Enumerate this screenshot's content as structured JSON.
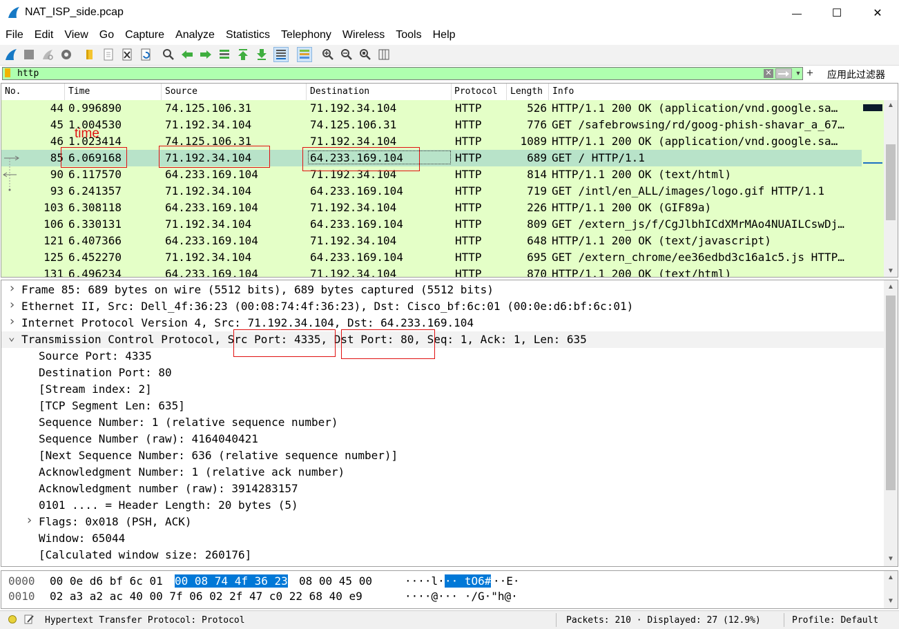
{
  "window": {
    "title": "NAT_ISP_side.pcap",
    "minimize_glyph": "—",
    "maximize_glyph": "☐",
    "close_glyph": "✕"
  },
  "menu": [
    "File",
    "Edit",
    "View",
    "Go",
    "Capture",
    "Analyze",
    "Statistics",
    "Telephony",
    "Wireless",
    "Tools",
    "Help"
  ],
  "toolbar_icons": [
    "shark-fin-start-icon",
    "stop-capture-icon",
    "restart-capture-icon",
    "capture-options-icon",
    "open-file-icon",
    "save-file-icon",
    "close-file-icon",
    "reload-file-icon",
    "find-packet-icon",
    "go-back-icon",
    "go-forward-icon",
    "go-to-packet-icon",
    "go-first-icon",
    "go-last-icon",
    "auto-scroll-icon",
    "colorize-icon",
    "zoom-in-icon",
    "zoom-out-icon",
    "zoom-normal-icon",
    "resize-columns-icon"
  ],
  "filter": {
    "value": "http",
    "expression_label": "应用此过滤器",
    "plus_glyph": "+"
  },
  "packet_list": {
    "columns": [
      "No.",
      "Time",
      "Source",
      "Destination",
      "Protocol",
      "Length",
      "Info"
    ],
    "rows": [
      {
        "no": "44",
        "time": "0.996890",
        "src": "74.125.106.31",
        "dst": "71.192.34.104",
        "proto": "HTTP",
        "len": "526",
        "info": "HTTP/1.1 200 OK  (application/vnd.google.sa…"
      },
      {
        "no": "45",
        "time": "1.004530",
        "src": "71.192.34.104",
        "dst": "74.125.106.31",
        "proto": "HTTP",
        "len": "776",
        "info": "GET /safebrowsing/rd/goog-phish-shavar_a_67…"
      },
      {
        "no": "46",
        "time": "1.023414",
        "src": "74.125.106.31",
        "dst": "71.192.34.104",
        "proto": "HTTP",
        "len": "1089",
        "info": "HTTP/1.1 200 OK  (application/vnd.google.sa…"
      },
      {
        "no": "85",
        "time": "6.069168",
        "src": "71.192.34.104",
        "dst": "64.233.169.104",
        "proto": "HTTP",
        "len": "689",
        "info": "GET / HTTP/1.1"
      },
      {
        "no": "90",
        "time": "6.117570",
        "src": "64.233.169.104",
        "dst": "71.192.34.104",
        "proto": "HTTP",
        "len": "814",
        "info": "HTTP/1.1 200 OK  (text/html)"
      },
      {
        "no": "93",
        "time": "6.241357",
        "src": "71.192.34.104",
        "dst": "64.233.169.104",
        "proto": "HTTP",
        "len": "719",
        "info": "GET /intl/en_ALL/images/logo.gif HTTP/1.1"
      },
      {
        "no": "103",
        "time": "6.308118",
        "src": "64.233.169.104",
        "dst": "71.192.34.104",
        "proto": "HTTP",
        "len": "226",
        "info": "HTTP/1.1 200 OK  (GIF89a)"
      },
      {
        "no": "106",
        "time": "6.330131",
        "src": "71.192.34.104",
        "dst": "64.233.169.104",
        "proto": "HTTP",
        "len": "809",
        "info": "GET /extern_js/f/CgJlbhICdXMrMAo4NUAILCswDj…"
      },
      {
        "no": "121",
        "time": "6.407366",
        "src": "64.233.169.104",
        "dst": "71.192.34.104",
        "proto": "HTTP",
        "len": "648",
        "info": "HTTP/1.1 200 OK  (text/javascript)"
      },
      {
        "no": "125",
        "time": "6.452270",
        "src": "71.192.34.104",
        "dst": "64.233.169.104",
        "proto": "HTTP",
        "len": "695",
        "info": "GET /extern_chrome/ee36edbd3c16a1c5.js HTTP…"
      },
      {
        "no": "131",
        "time": "6.496234",
        "src": "64.233.169.104",
        "dst": "71.192.34.104",
        "proto": "HTTP",
        "len": "870",
        "info": "HTTP/1.1 200 OK  (text/html)"
      }
    ],
    "selected_no": "85",
    "row_bg": "#e4ffc7",
    "selected_bg": "#b8e3c9"
  },
  "details": [
    {
      "indent": 0,
      "arrow": ">",
      "text": "Frame 85: 689 bytes on wire (5512 bits), 689 bytes captured (5512 bits)"
    },
    {
      "indent": 0,
      "arrow": ">",
      "text": "Ethernet II, Src: Dell_4f:36:23 (00:08:74:4f:36:23), Dst: Cisco_bf:6c:01 (00:0e:d6:bf:6c:01)"
    },
    {
      "indent": 0,
      "arrow": ">",
      "text": "Internet Protocol Version 4, Src: 71.192.34.104, Dst: 64.233.169.104"
    },
    {
      "indent": 0,
      "arrow": "v",
      "text": "Transmission Control Protocol, Src Port: 4335, Dst Port: 80, Seq: 1, Ack: 1, Len: 635"
    },
    {
      "indent": 1,
      "arrow": "",
      "text": "Source Port: 4335"
    },
    {
      "indent": 1,
      "arrow": "",
      "text": "Destination Port: 80"
    },
    {
      "indent": 1,
      "arrow": "",
      "text": "[Stream index: 2]"
    },
    {
      "indent": 1,
      "arrow": "",
      "text": "[TCP Segment Len: 635]"
    },
    {
      "indent": 1,
      "arrow": "",
      "text": "Sequence Number: 1    (relative sequence number)"
    },
    {
      "indent": 1,
      "arrow": "",
      "text": "Sequence Number (raw): 4164040421"
    },
    {
      "indent": 1,
      "arrow": "",
      "text": "[Next Sequence Number: 636    (relative sequence number)]"
    },
    {
      "indent": 1,
      "arrow": "",
      "text": "Acknowledgment Number: 1    (relative ack number)"
    },
    {
      "indent": 1,
      "arrow": "",
      "text": "Acknowledgment number (raw): 3914283157"
    },
    {
      "indent": 1,
      "arrow": "",
      "text": "0101 .... = Header Length: 20 bytes (5)"
    },
    {
      "indent": 1,
      "arrow": ">",
      "text": "Flags: 0x018 (PSH, ACK)"
    },
    {
      "indent": 1,
      "arrow": "",
      "text": "Window: 65044"
    },
    {
      "indent": 1,
      "arrow": "",
      "text": "[Calculated window size: 260176]"
    }
  ],
  "bytes": [
    {
      "offset": "0000",
      "pre": "00 0e d6 bf 6c 01 ",
      "hl": "00 08  74 4f 36 23",
      "post": " 08 00 45 00",
      "ascii_pre": "····l·",
      "ascii_hl": "·· tO6#",
      "ascii_post": "··E·"
    },
    {
      "offset": "0010",
      "pre": "02 a3 a2 ac 40 00 7f 06  02 2f 47 c0 22 68 40 e9",
      "hl": "",
      "post": "",
      "ascii_pre": "····@··· ·/G·\"h@·",
      "ascii_hl": "",
      "ascii_post": ""
    }
  ],
  "status": {
    "field": "Hypertext Transfer Protocol: Protocol",
    "packets": "Packets: 210 · Displayed: 27 (12.9%)",
    "profile": "Profile: Default"
  },
  "annotations": {
    "time_label": "time",
    "color": "#e01010"
  },
  "colors": {
    "filter_bg": "#afffaf",
    "highlight": "#0078d7"
  }
}
